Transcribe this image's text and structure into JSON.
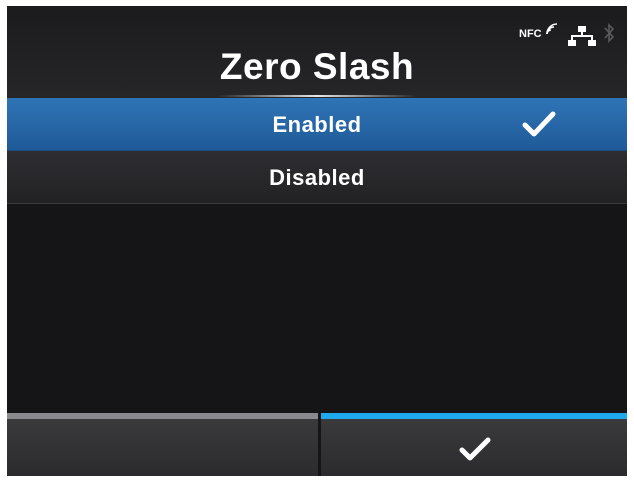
{
  "header": {
    "title": "Zero Slash",
    "status": {
      "nfc_label": "NFC",
      "icons": [
        "nfc-icon",
        "lan-icon",
        "bluetooth-icon"
      ]
    }
  },
  "options": [
    {
      "label": "Enabled",
      "selected": true
    },
    {
      "label": "Disabled",
      "selected": false
    }
  ],
  "softkeys": {
    "left": {
      "label": "",
      "accent": "#8a8a8e"
    },
    "right": {
      "icon": "check-icon",
      "accent": "#1da9ec"
    }
  },
  "colors": {
    "selection": "#2a6aab",
    "background": "#151517",
    "text": "#ffffff"
  }
}
